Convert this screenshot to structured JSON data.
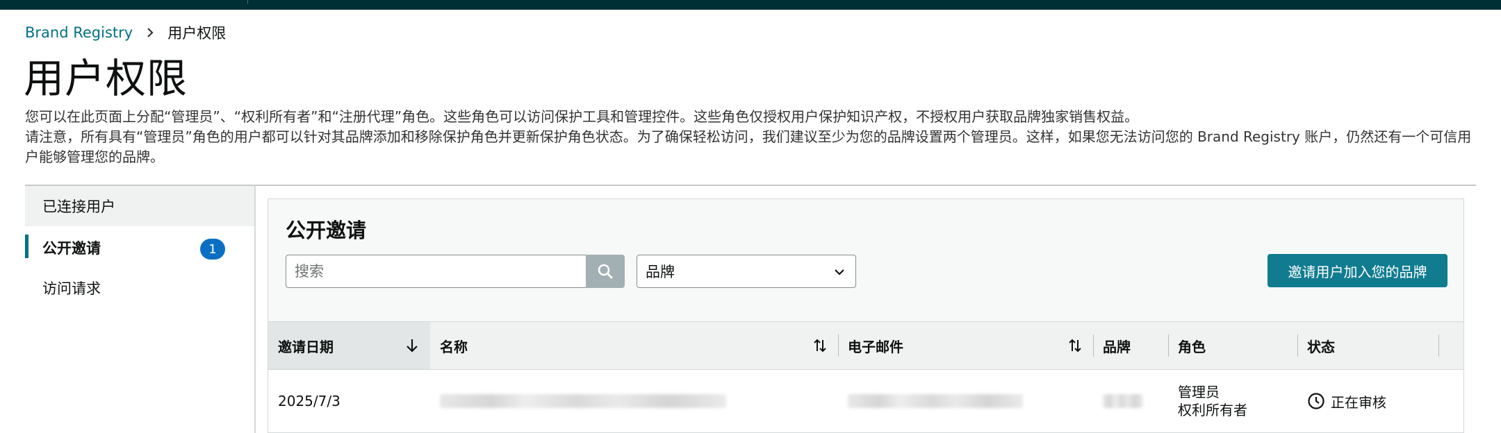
{
  "breadcrumb": {
    "root": "Brand Registry",
    "current": "用户权限"
  },
  "page": {
    "title": "用户权限",
    "desc_line1": "您可以在此页面上分配“管理员”、“权利所有者”和“注册代理”角色。这些角色可以访问保护工具和管理控件。这些角色仅授权用户保护知识产权，不授权用户获取品牌独家销售权益。",
    "desc_line2": "请注意，所有具有“管理员”角色的用户都可以针对其品牌添加和移除保护角色并更新保护角色状态。为了确保轻松访问，我们建议至少为您的品牌设置两个管理员。这样，如果您无法访问您的 Brand Registry 账户，仍然还有一个可信用户能够管理您的品牌。"
  },
  "sidebar": {
    "items": [
      {
        "label": "已连接用户"
      },
      {
        "label": "公开邀请",
        "badge": "1"
      },
      {
        "label": "访问请求"
      }
    ]
  },
  "panel": {
    "title": "公开邀请",
    "search_placeholder": "搜索",
    "brand_select_value": "品牌",
    "invite_button": "邀请用户加入您的品牌"
  },
  "table": {
    "columns": [
      "邀请日期",
      "名称",
      "电子邮件",
      "品牌",
      "角色",
      "状态"
    ],
    "rows": [
      {
        "date": "2025/7/3",
        "roles": [
          "管理员",
          "权利所有者"
        ],
        "status": "正在审核"
      }
    ]
  },
  "colors": {
    "accent": "#007185",
    "primary_button": "#117c8f",
    "badge": "#0a6fc2",
    "topbar": "#002f36"
  },
  "icons": [
    "chevron-right-icon",
    "search-icon",
    "chevron-down-icon",
    "sort-down-icon",
    "sort-both-icon",
    "clock-icon"
  ]
}
